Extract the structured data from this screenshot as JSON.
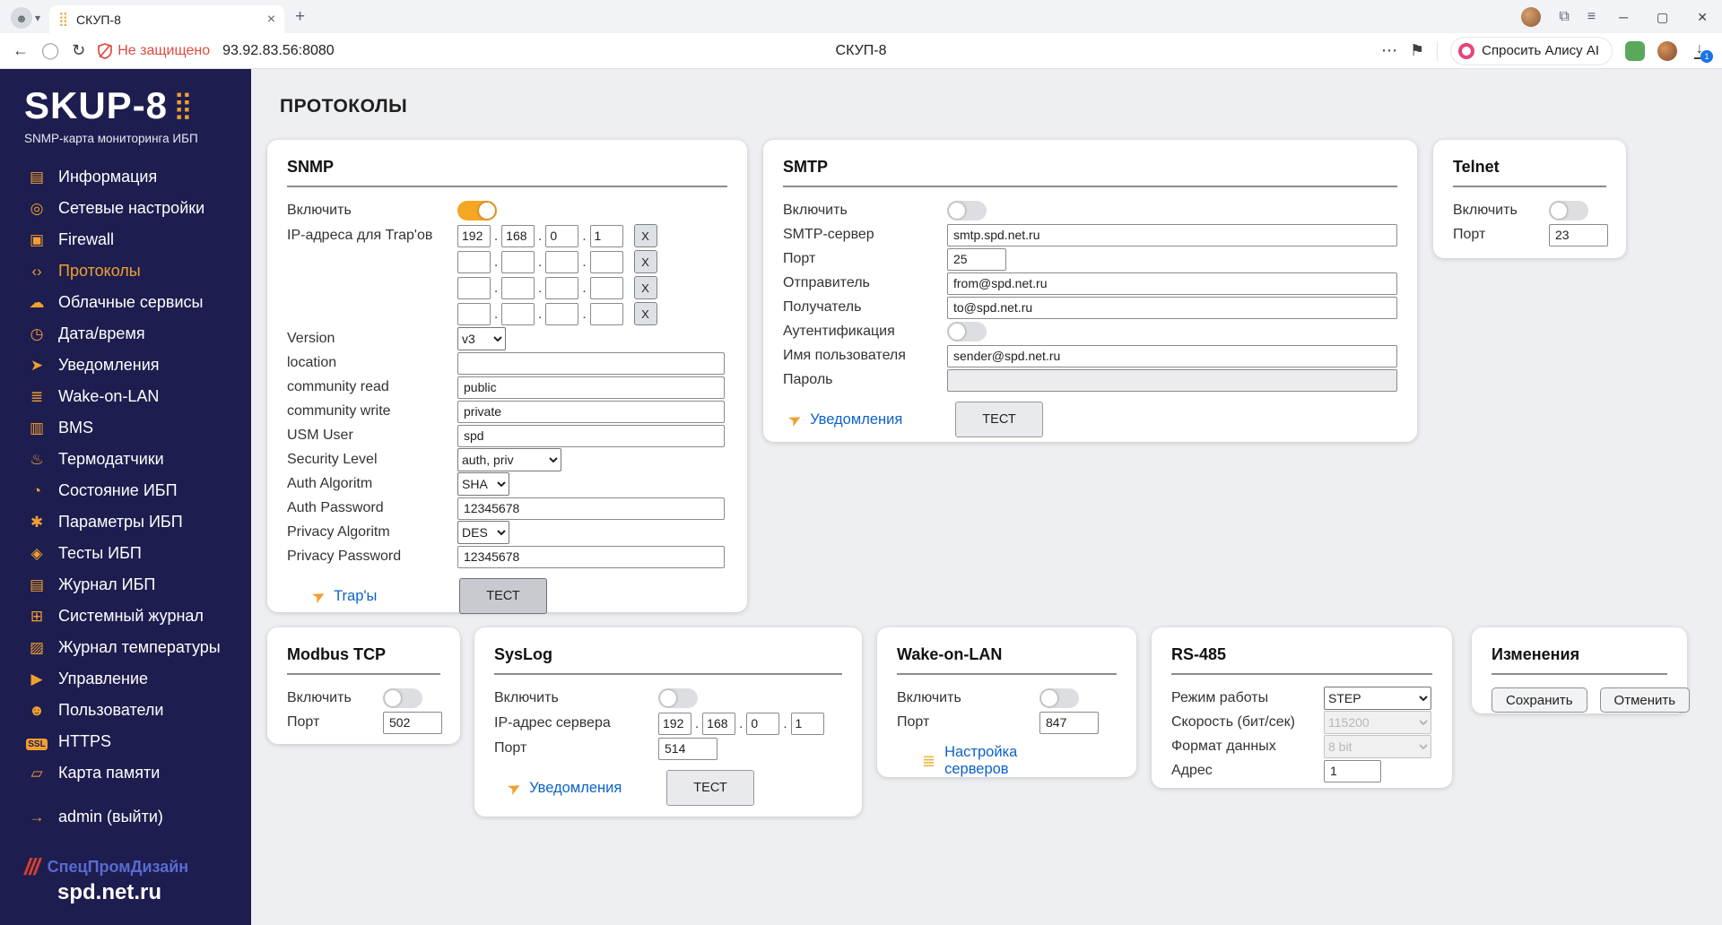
{
  "ui": {
    "dot": "."
  },
  "icons": {
    "favicon": "⣿",
    "logo_dots": "⣿",
    "chevron_down": "▾",
    "tab_close": "×",
    "new_tab": "+",
    "panels": "⧉",
    "menu": "≡",
    "minimize": "─",
    "maximize": "▢",
    "close": "✕",
    "back": "←",
    "circle": "◯",
    "refresh": "↻",
    "more": "⋯",
    "bookmark": "⚑",
    "download": "↓",
    "plane": "➤",
    "servers": "≣",
    "stripes": "///",
    "profile": "☻"
  },
  "browser": {
    "tab_title": "СКУП-8",
    "security": "Не защищено",
    "url": "93.92.83.56:8080",
    "center_title": "СКУП-8",
    "alice": "Спросить Алису AI",
    "download_badge": "1"
  },
  "sidebar": {
    "logo": "SKUP-8",
    "subtitle": "SNMP-карта мониторинга ИБП",
    "items": [
      {
        "label": "Информация",
        "glyph": "▤"
      },
      {
        "label": "Сетевые настройки",
        "glyph": "◎"
      },
      {
        "label": "Firewall",
        "glyph": "▣"
      },
      {
        "label": "Протоколы",
        "glyph": "‹›"
      },
      {
        "label": "Облачные сервисы",
        "glyph": "☁"
      },
      {
        "label": "Дата/время",
        "glyph": "◷"
      },
      {
        "label": "Уведомления",
        "glyph": "➤"
      },
      {
        "label": "Wake-on-LAN",
        "glyph": "≣"
      },
      {
        "label": "BMS",
        "glyph": "▥"
      },
      {
        "label": "Термодатчики",
        "glyph": "♨"
      },
      {
        "label": "Состояние ИБП",
        "glyph": "◔"
      },
      {
        "label": "Параметры ИБП",
        "glyph": "✱"
      },
      {
        "label": "Тесты ИБП",
        "glyph": "◈"
      },
      {
        "label": "Журнал ИБП",
        "glyph": "▤"
      },
      {
        "label": "Системный журнал",
        "glyph": "⊞"
      },
      {
        "label": "Журнал температуры",
        "glyph": "▨"
      },
      {
        "label": "Управление",
        "glyph": "▶"
      },
      {
        "label": "Пользователи",
        "glyph": "☻"
      },
      {
        "label": "HTTPS",
        "glyph": "SSL"
      },
      {
        "label": "Карта памяти",
        "glyph": "▱"
      },
      {
        "label": "admin (выйти)",
        "glyph": "→"
      }
    ],
    "footer": {
      "brand": "СпецПромДизайн",
      "site": "spd.net.ru"
    }
  },
  "page": {
    "title": "ПРОТОКОЛЫ"
  },
  "cards": {
    "snmp": {
      "title": "SNMP",
      "enable": "Включить",
      "trap_ips_label": "IP-адреса для Trap'ов",
      "remove": "X",
      "trap_rows": [
        [
          "192",
          "168",
          "0",
          "1"
        ],
        [
          "",
          "",
          "",
          ""
        ],
        [
          "",
          "",
          "",
          ""
        ],
        [
          "",
          "",
          "",
          ""
        ]
      ],
      "version_label": "Version",
      "version_value": "v3",
      "location_label": "location",
      "location_value": "",
      "community_read_label": "community read",
      "community_read_value": "public",
      "community_write_label": "community write",
      "community_write_value": "private",
      "usm_user_label": "USM User",
      "usm_user_value": "spd",
      "security_level_label": "Security Level",
      "security_level_value": "auth, priv",
      "auth_alg_label": "Auth Algoritm",
      "auth_alg_value": "SHA",
      "auth_pw_label": "Auth Password",
      "auth_pw_value": "12345678",
      "priv_alg_label": "Privacy Algoritm",
      "priv_alg_value": "DES",
      "priv_pw_label": "Privacy Password",
      "priv_pw_value": "12345678",
      "traps_link": "Trap'ы",
      "test": "ТЕСТ"
    },
    "smtp": {
      "title": "SMTP",
      "enable": "Включить",
      "server_label": "SMTP-сервер",
      "server_value": "smtp.spd.net.ru",
      "port_label": "Порт",
      "port_value": "25",
      "from_label": "Отправитель",
      "from_value": "from@spd.net.ru",
      "to_label": "Получатель",
      "to_value": "to@spd.net.ru",
      "auth_label": "Аутентификация",
      "user_label": "Имя пользователя",
      "user_value": "sender@spd.net.ru",
      "password_label": "Пароль",
      "password_value": "",
      "notify_link": "Уведомления",
      "test": "ТЕСТ"
    },
    "telnet": {
      "title": "Telnet",
      "enable": "Включить",
      "port_label": "Порт",
      "port_value": "23"
    },
    "modbus": {
      "title": "Modbus TCP",
      "enable": "Включить",
      "port_label": "Порт",
      "port_value": "502"
    },
    "syslog": {
      "title": "SysLog",
      "enable": "Включить",
      "server_label": "IP-адрес сервера",
      "ip": [
        "192",
        "168",
        "0",
        "1"
      ],
      "port_label": "Порт",
      "port_value": "514",
      "notify_link": "Уведомления",
      "test": "ТЕСТ"
    },
    "wol": {
      "title": "Wake-on-LAN",
      "enable": "Включить",
      "port_label": "Порт",
      "port_value": "847",
      "servers_link": "Настройка серверов"
    },
    "rs485": {
      "title": "RS-485",
      "mode_label": "Режим работы",
      "mode_value": "STEP",
      "speed_label": "Скорость (бит/сек)",
      "speed_value": "115200",
      "format_label": "Формат данных",
      "format_value": "8 bit",
      "addr_label": "Адрес",
      "addr_value": "1"
    },
    "changes": {
      "title": "Изменения",
      "save": "Сохранить",
      "cancel": "Отменить"
    }
  }
}
